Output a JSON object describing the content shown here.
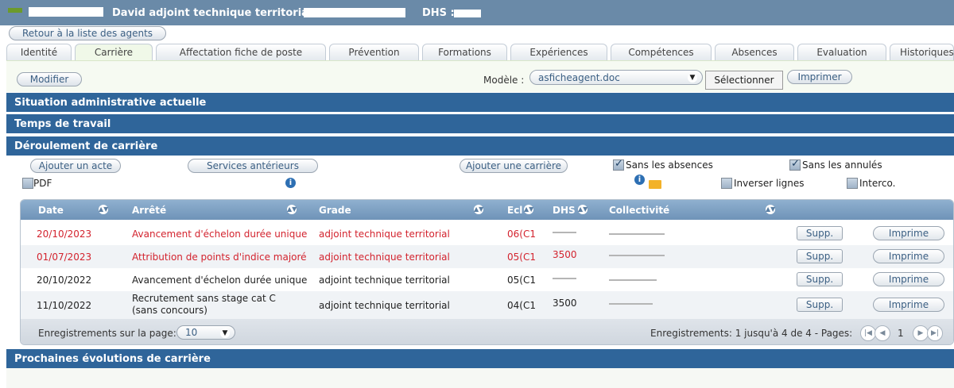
{
  "header": {
    "name_text": "David  adjoint technique territorial",
    "dhs_label": "DHS :"
  },
  "nav": {
    "back_label": "Retour à la liste des agents"
  },
  "tabs": [
    {
      "label": "Identité"
    },
    {
      "label": "Carrière"
    },
    {
      "label": "Affectation fiche de poste"
    },
    {
      "label": "Prévention"
    },
    {
      "label": "Formations"
    },
    {
      "label": "Expériences"
    },
    {
      "label": "Compétences"
    },
    {
      "label": "Absences"
    },
    {
      "label": "Evaluation"
    },
    {
      "label": "Historiques"
    }
  ],
  "toolbar": {
    "modifier_label": "Modifier",
    "modele_label": "Modèle :",
    "modele_value": "asficheagent.doc",
    "selectionner_label": "Sélectionner",
    "imprimer_label": "Imprimer"
  },
  "sections": {
    "situation": "Situation administrative actuelle",
    "temps": "Temps de travail",
    "deroulement": "Déroulement de carrière",
    "prochaines": "Prochaines évolutions de carrière"
  },
  "actions": {
    "ajouter_acte": "Ajouter un acte",
    "services_anterieurs": "Services antérieurs",
    "ajouter_carriere": "Ajouter une carrière",
    "sans_absences": "Sans les absences",
    "sans_annules": "Sans les annulés",
    "pdf": "PDF",
    "inverser_lignes": "Inverser lignes",
    "interco": "Interco."
  },
  "table": {
    "headers": [
      "Date",
      "Arrêté",
      "Grade",
      "Ecl",
      "DHS",
      "Collectivité"
    ],
    "rows": [
      {
        "date": "20/10/2023",
        "arrete": "Avancement d'échelon durée unique",
        "grade": "adjoint technique territorial",
        "ecl": "06(C1",
        "highlight": true
      },
      {
        "date": "01/07/2023",
        "arrete": "Attribution de points d'indice majoré",
        "grade": "adjoint technique territorial",
        "ecl": "05(C1",
        "dhs": "3500",
        "highlight": true
      },
      {
        "date": "20/10/2022",
        "arrete": "Avancement d'échelon durée unique",
        "grade": "adjoint technique territorial",
        "ecl": "05(C1",
        "highlight": false
      },
      {
        "date": "11/10/2022",
        "arrete_line1": "Recrutement sans stage cat C",
        "arrete_line2": "(sans concours)",
        "grade": "adjoint technique territorial",
        "ecl": "04(C1",
        "dhs": "3500",
        "highlight": false
      }
    ],
    "supp_label": "Supp.",
    "imprime_label": "Imprime",
    "footer_left": "Enregistrements sur la page:",
    "page_size": "10",
    "footer_right": "Enregistrements: 1 jusqu'à 4 de 4 - Pages:",
    "current_page": "1"
  },
  "colors": {
    "section_bg": "#2f659a",
    "header_bg": "#6a8aa8",
    "highlight_text": "#d3232e"
  }
}
